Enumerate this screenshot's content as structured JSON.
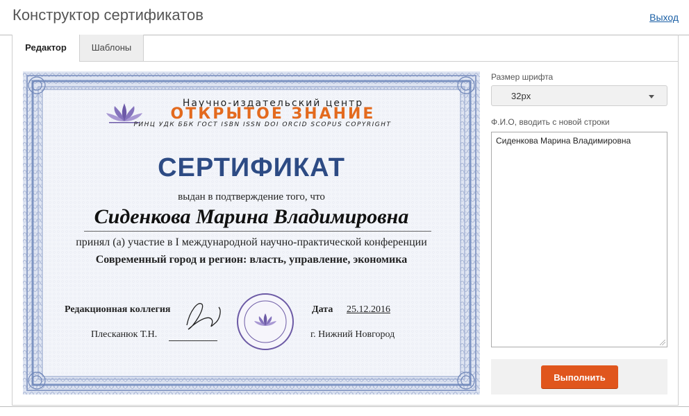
{
  "header": {
    "title": "Конструктор сертификатов",
    "logout_label": "Выход"
  },
  "tabs": [
    {
      "label": "Редактор",
      "active": true
    },
    {
      "label": "Шаблоны",
      "active": false
    }
  ],
  "certificate": {
    "org_name": "Научно-издательский центр",
    "brand": "ОТКРЫТОЕ ЗНАНИЕ",
    "services": "РИНЦ УДК ББК ГОСТ ISBN ISSN DOI ORCID SCOPUS COPYRIGHT",
    "title": "СЕРТИФИКАТ",
    "issued_text": "выдан в подтверждение того, что",
    "recipient": "Сиденкова Марина Владимировна",
    "participation_text": "принял (а) участие в I международной научно-практической конференции",
    "conference": "Современный город и регион: власть, управление, экономика",
    "editorial_label": "Редакционная коллегия",
    "signer": "Плесканюк Т.Н.",
    "date_label": "Дата",
    "date": "25.12.2016",
    "city": "г. Нижний Новгород",
    "colors": {
      "title": "#2d4b84",
      "brand": "#e36a1e",
      "frame": "#7d94c2",
      "seal": "#6c5aa5"
    }
  },
  "form": {
    "font_size_label": "Размер шрифта",
    "font_size_value": "32px",
    "name_label": "Ф.И.О, вводить с новой строки",
    "name_value": "Сиденкова Марина Владимировна",
    "submit_label": "Выполнить"
  },
  "colors": {
    "accent_button": "#e0561d",
    "link": "#1a5fa5"
  }
}
